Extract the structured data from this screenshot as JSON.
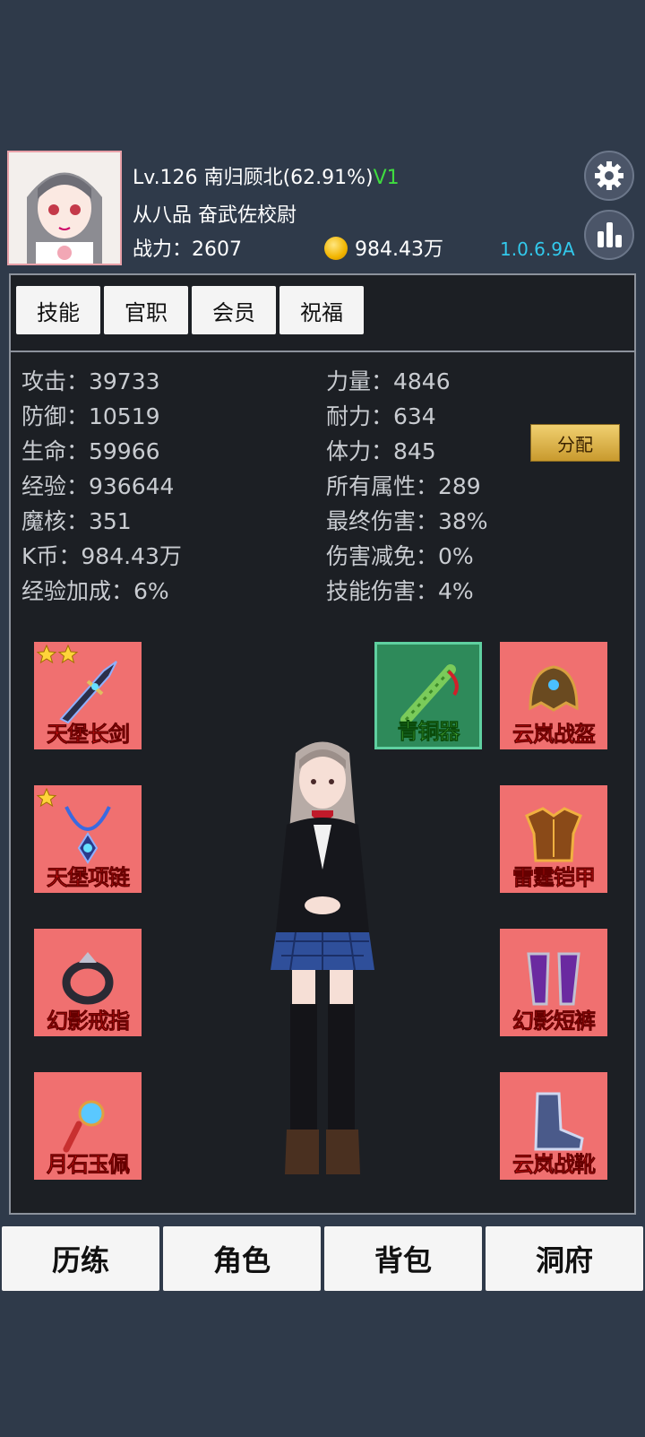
{
  "header": {
    "level": "Lv.126",
    "name": "南归顾北(62.91%)",
    "vip": "V1",
    "rank_title": "从八品  奋武佐校尉",
    "power_label": "战力：",
    "power_value": "2607",
    "gold": "984.43万",
    "version": "1.0.6.9A"
  },
  "tabs": [
    "技能",
    "官职",
    "会员",
    "祝福"
  ],
  "stats_left": [
    "攻击：39733",
    "防御：10519",
    "生命：59966",
    "经验：936644",
    "魔核：351",
    "K币：984.43万",
    "经验加成：6%"
  ],
  "stats_right": [
    "力量：4846",
    "耐力：634",
    "体力：845",
    "所有属性：289",
    "最终伤害：38%",
    "伤害减免：0%",
    "技能伤害：4%"
  ],
  "allocate_label": "分配",
  "equipment": {
    "weapon": {
      "name": "天堡长剑",
      "stars": 2
    },
    "artifact": {
      "name": "青铜器",
      "stars": 0
    },
    "helmet": {
      "name": "云岚战盔",
      "stars": 0
    },
    "necklace": {
      "name": "天堡项链",
      "stars": 1
    },
    "armor": {
      "name": "雷霆铠甲",
      "stars": 0
    },
    "ring": {
      "name": "幻影戒指",
      "stars": 0
    },
    "pants": {
      "name": "幻影短裤",
      "stars": 0
    },
    "pendant": {
      "name": "月石玉佩",
      "stars": 0
    },
    "boots": {
      "name": "云岚战靴",
      "stars": 0
    }
  },
  "bottom_nav": [
    "历练",
    "角色",
    "背包",
    "洞府"
  ],
  "icons": {
    "settings": "gear-icon",
    "stats": "bar-chart-icon",
    "coin": "gold-coin-icon"
  },
  "colors": {
    "background": "#2f3a4a",
    "panel": "#1c1f24",
    "vip": "#3fdc3f",
    "version": "#32c9ec",
    "slot_red": "#f07070",
    "slot_green": "#2e8a5a"
  }
}
